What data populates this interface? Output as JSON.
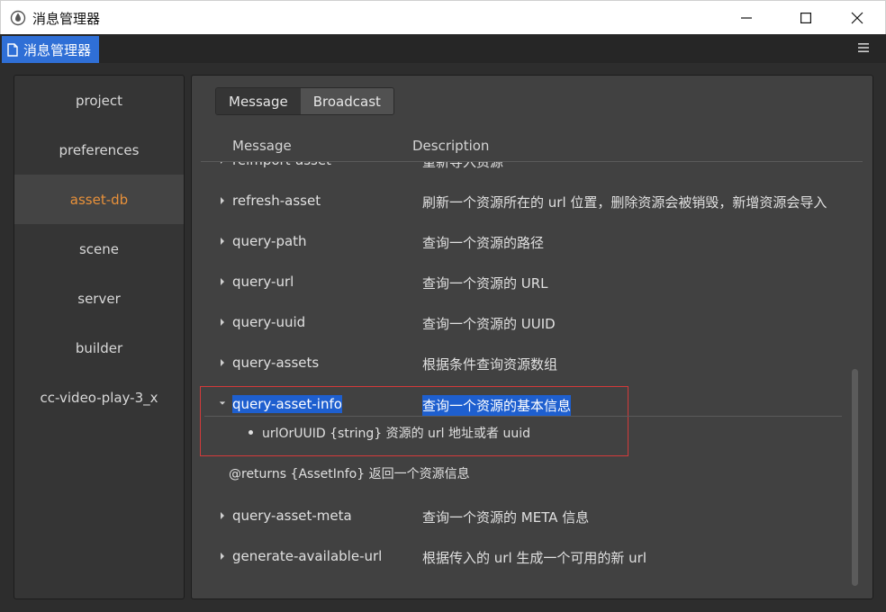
{
  "window": {
    "title": "消息管理器"
  },
  "panel_tab": {
    "label": "消息管理器"
  },
  "sidebar": {
    "items": [
      {
        "label": "project"
      },
      {
        "label": "preferences"
      },
      {
        "label": "asset-db",
        "active": true
      },
      {
        "label": "scene"
      },
      {
        "label": "server"
      },
      {
        "label": "builder"
      },
      {
        "label": "cc-video-play-3_x"
      }
    ]
  },
  "segmented": {
    "message": "Message",
    "broadcast": "Broadcast",
    "active": "Message"
  },
  "columns": {
    "message": "Message",
    "description": "Description"
  },
  "rows": [
    {
      "name": "reimport-asset",
      "desc": "重新导入资源"
    },
    {
      "name": "refresh-asset",
      "desc": "刷新一个资源所在的 url 位置，删除资源会被销毁，新增资源会导入"
    },
    {
      "name": "query-path",
      "desc": "查询一个资源的路径"
    },
    {
      "name": "query-url",
      "desc": "查询一个资源的 URL"
    },
    {
      "name": "query-uuid",
      "desc": "查询一个资源的 UUID"
    },
    {
      "name": "query-assets",
      "desc": "根据条件查询资源数组"
    },
    {
      "name": "query-asset-info",
      "desc": "查询一个资源的基本信息",
      "expanded": true
    },
    {
      "name": "query-asset-meta",
      "desc": "查询一个资源的 META 信息"
    },
    {
      "name": "generate-available-url",
      "desc": "根据传入的 url 生成一个可用的新 url"
    }
  ],
  "detail": {
    "param": "urlOrUUID {string} 资源的 url 地址或者 uuid",
    "returns": "@returns {AssetInfo} 返回一个资源信息"
  },
  "colors": {
    "accent": "#e9913a",
    "highlight": "#1e5fcf",
    "tab_blue": "#2f6fd6",
    "annotation_red": "#d43a3a"
  },
  "icons": [
    "app-logo-icon",
    "minimize-icon",
    "maximize-icon",
    "close-icon",
    "document-icon",
    "menu-icon",
    "caret-right-icon",
    "caret-down-icon"
  ]
}
